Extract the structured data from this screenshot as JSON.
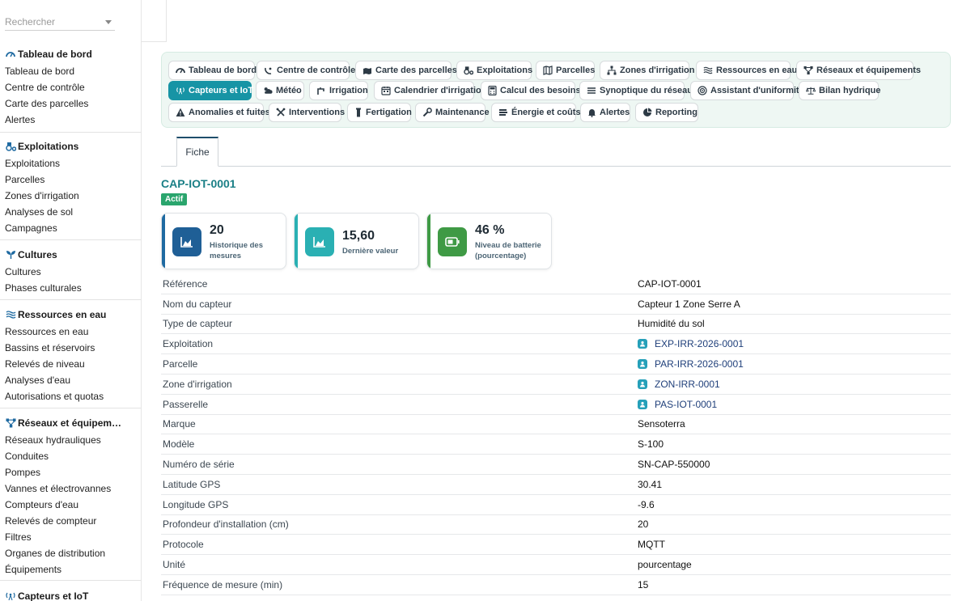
{
  "search": {
    "placeholder": "Rechercher"
  },
  "sidebar": {
    "groups": [
      {
        "title": "Tableau de bord",
        "icon": "gauge-icon",
        "items": [
          "Tableau de bord",
          "Centre de contrôle",
          "Carte des parcelles",
          "Alertes"
        ]
      },
      {
        "title": "Exploitations",
        "icon": "tractor-icon",
        "items": [
          "Exploitations",
          "Parcelles",
          "Zones d'irrigation",
          "Analyses de sol",
          "Campagnes"
        ]
      },
      {
        "title": "Cultures",
        "icon": "seedling-icon",
        "items": [
          "Cultures",
          "Phases culturales"
        ]
      },
      {
        "title": "Ressources en eau",
        "icon": "water-icon",
        "items": [
          "Ressources en eau",
          "Bassins et réservoirs",
          "Relevés de niveau",
          "Analyses d'eau",
          "Autorisations et quotas"
        ]
      },
      {
        "title": "Réseaux et équipem…",
        "icon": "network-icon",
        "items": [
          "Réseaux hydrauliques",
          "Conduites",
          "Pompes",
          "Vannes et électrovannes",
          "Compteurs d'eau",
          "Relevés de compteur",
          "Filtres",
          "Organes de distribution",
          "Équipements"
        ]
      },
      {
        "title": "Capteurs et IoT",
        "icon": "tower-broadcast-icon",
        "items": []
      }
    ]
  },
  "modules": [
    {
      "label": "Tableau de bord",
      "icon": "gauge-icon"
    },
    {
      "label": "Centre de contrôle",
      "icon": "satellite-dish-icon"
    },
    {
      "label": "Carte des parcelles",
      "icon": "map-location-icon"
    },
    {
      "label": "Exploitations",
      "icon": "tractor-icon"
    },
    {
      "label": "Parcelles",
      "icon": "map-icon"
    },
    {
      "label": "Zones d'irrigation",
      "icon": "sitemap-icon"
    },
    {
      "label": "Ressources en eau",
      "icon": "water-icon"
    },
    {
      "label": "Réseaux et équipements",
      "icon": "network-icon"
    },
    {
      "label": "Capteurs et IoT",
      "icon": "tower-broadcast-icon"
    },
    {
      "label": "Météo",
      "icon": "cloud-sun-icon"
    },
    {
      "label": "Irrigation",
      "icon": "faucet-icon"
    },
    {
      "label": "Calendrier d'irrigation",
      "icon": "calendar-icon"
    },
    {
      "label": "Calcul des besoins",
      "icon": "calculator-icon"
    },
    {
      "label": "Synoptique du réseau",
      "icon": "list-icon"
    },
    {
      "label": "Assistant d'uniformité",
      "icon": "bullseye-icon"
    },
    {
      "label": "Bilan hydrique",
      "icon": "scale-icon"
    },
    {
      "label": "Anomalies et fuites",
      "icon": "warning-icon"
    },
    {
      "label": "Interventions",
      "icon": "tools-icon"
    },
    {
      "label": "Fertigation",
      "icon": "flask-icon"
    },
    {
      "label": "Maintenance",
      "icon": "wrench-icon"
    },
    {
      "label": "Énergie et coûts",
      "icon": "coins-icon"
    },
    {
      "label": "Alertes",
      "icon": "bell-icon"
    },
    {
      "label": "Reporting",
      "icon": "chart-pie-icon"
    }
  ],
  "active_module": "Capteurs et IoT",
  "tab": {
    "label": "Fiche"
  },
  "record": {
    "title": "CAP-IOT-0001",
    "status": "Actif"
  },
  "stats": [
    {
      "value": "20",
      "label": "Historique des mesures",
      "color": "#1f6aa1"
    },
    {
      "value": "15,60",
      "label": "Dernière valeur",
      "color": "#2ab0b3"
    },
    {
      "value": "46 %",
      "label": "Niveau de batterie (pourcentage)",
      "color": "#3f9a45"
    }
  ],
  "fields": [
    {
      "label": "Référence",
      "value": "CAP-IOT-0001"
    },
    {
      "label": "Nom du capteur",
      "value": "Capteur 1 Zone Serre A"
    },
    {
      "label": "Type de capteur",
      "value": "Humidité du sol"
    },
    {
      "label": "Exploitation",
      "value": "EXP-IRR-2026-0001",
      "link": true
    },
    {
      "label": "Parcelle",
      "value": "PAR-IRR-2026-0001",
      "link": true
    },
    {
      "label": "Zone d'irrigation",
      "value": "ZON-IRR-0001",
      "link": true
    },
    {
      "label": "Passerelle",
      "value": "PAS-IOT-0001",
      "link": true
    },
    {
      "label": "Marque",
      "value": "Sensoterra"
    },
    {
      "label": "Modèle",
      "value": "S-100"
    },
    {
      "label": "Numéro de série",
      "value": "SN-CAP-550000"
    },
    {
      "label": "Latitude GPS",
      "value": "30.41"
    },
    {
      "label": "Longitude GPS",
      "value": "-9.6"
    },
    {
      "label": "Profondeur d'installation (cm)",
      "value": "20"
    },
    {
      "label": "Protocole",
      "value": "MQTT"
    },
    {
      "label": "Unité",
      "value": "pourcentage"
    },
    {
      "label": "Fréquence de mesure (min)",
      "value": "15"
    }
  ]
}
